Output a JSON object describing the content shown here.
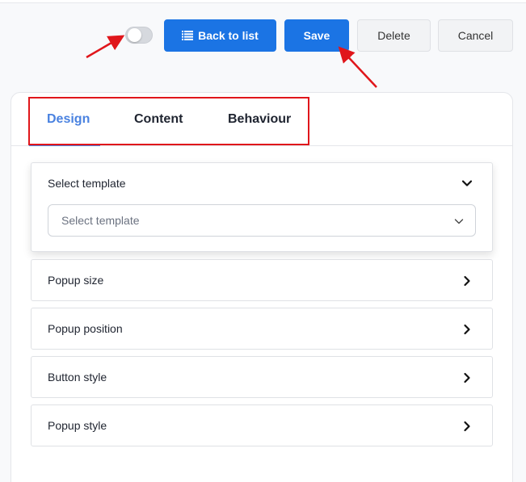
{
  "toolbar": {
    "toggle_state": "off",
    "back_label": "Back to list",
    "back_icon": "list-icon",
    "save_label": "Save",
    "delete_label": "Delete",
    "cancel_label": "Cancel",
    "primary_color": "#1b74e4"
  },
  "tabs": [
    {
      "label": "Design",
      "active": true
    },
    {
      "label": "Content",
      "active": false
    },
    {
      "label": "Behaviour",
      "active": false
    }
  ],
  "accordion": {
    "open_section": {
      "label": "Select template",
      "select_placeholder": "Select template",
      "icon": "chevron-down-icon"
    },
    "sections": [
      {
        "label": "Popup size",
        "icon": "chevron-right-icon"
      },
      {
        "label": "Popup position",
        "icon": "chevron-right-icon"
      },
      {
        "label": "Button style",
        "icon": "chevron-right-icon"
      },
      {
        "label": "Popup style",
        "icon": "chevron-right-icon"
      }
    ]
  },
  "annotation_color": "#e0161b"
}
